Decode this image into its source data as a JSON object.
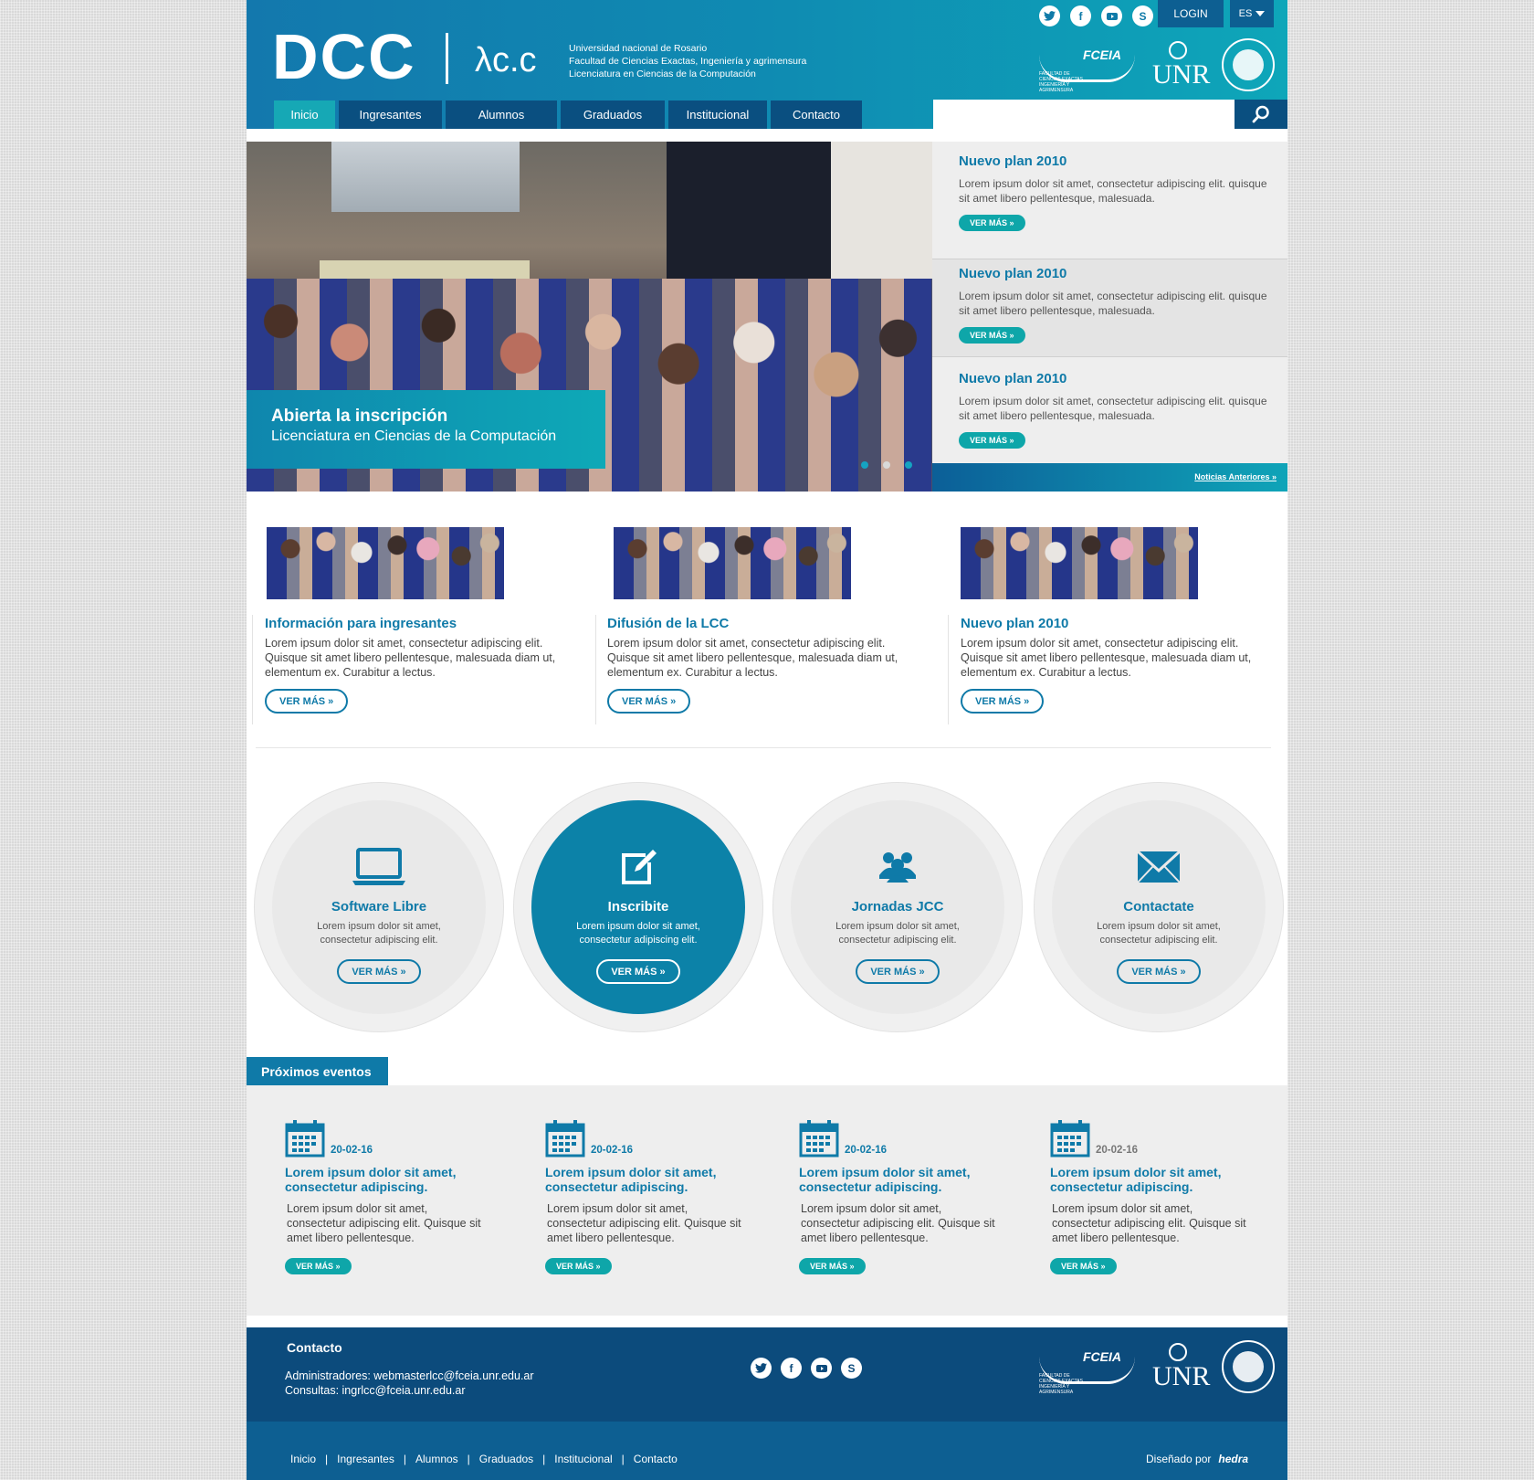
{
  "header": {
    "logo": "DCC",
    "logo_secondary": "λc.c",
    "lines": [
      "Universidad nacional de Rosario",
      "Facultad de Ciencias Exactas, Ingeniería y agrimensura",
      "Licenciatura en Ciencias de la Computación"
    ],
    "social": [
      "twitter-icon",
      "facebook-icon",
      "youtube-icon",
      "skype-icon"
    ],
    "login": "LOGIN",
    "lang": "ES",
    "logos": {
      "fceia": "FCEIA",
      "fceia_small": "FACULTAD DE CIENCIAS EXACTAS, INGENIERÍA Y AGRIMENSURA",
      "unr": "UNR"
    }
  },
  "nav": [
    {
      "label": "Inicio",
      "active": true
    },
    {
      "label": "Ingresantes",
      "active": false
    },
    {
      "label": "Alumnos",
      "active": false
    },
    {
      "label": "Graduados",
      "active": false
    },
    {
      "label": "Institucional",
      "active": false
    },
    {
      "label": "Contacto",
      "active": false
    }
  ],
  "search": {
    "placeholder": ""
  },
  "hero": {
    "title": "Abierta la inscripción",
    "subtitle": "Licenciatura en Ciencias de la Computación",
    "slides": 3,
    "active_slide": 1
  },
  "news": {
    "items": [
      {
        "title": "Nuevo plan 2010",
        "text": "Lorem ipsum dolor sit amet, consectetur adipiscing elit. quisque sit amet libero pellentesque, malesuada.",
        "button": "VER MÁS »"
      },
      {
        "title": "Nuevo plan 2010",
        "text": "Lorem ipsum dolor sit amet, consectetur adipiscing elit. quisque sit amet libero pellentesque, malesuada.",
        "button": "VER MÁS »"
      },
      {
        "title": "Nuevo plan 2010",
        "text": "Lorem ipsum dolor sit amet, consectetur adipiscing elit. quisque sit amet libero pellentesque, malesuada.",
        "button": "VER MÁS »"
      }
    ],
    "more": "Noticias Anteriores »"
  },
  "features": [
    {
      "title": "Información para ingresantes",
      "text": "Lorem ipsum dolor sit amet, consectetur adipiscing elit. Quisque sit amet libero pellentesque, malesuada diam ut, elementum ex. Curabitur a lectus.",
      "button": "VER MÁS »"
    },
    {
      "title": "Difusión de la LCC",
      "text": "Lorem ipsum dolor sit amet, consectetur adipiscing elit. Quisque sit amet libero pellentesque, malesuada diam ut, elementum ex. Curabitur a lectus.",
      "button": "VER MÁS »"
    },
    {
      "title": "Nuevo plan 2010",
      "text": "Lorem ipsum dolor sit amet, consectetur adipiscing elit. Quisque sit amet libero pellentesque, malesuada diam ut, elementum ex. Curabitur a lectus.",
      "button": "VER MÁS »"
    }
  ],
  "circles": [
    {
      "icon": "laptop-icon",
      "title": "Software Libre",
      "text": "Lorem ipsum dolor sit amet, consectetur adipiscing elit.",
      "button": "VER MÁS »"
    },
    {
      "icon": "edit-icon",
      "title": "Inscribite",
      "text": "Lorem ipsum dolor sit amet, consectetur adipiscing elit.",
      "button": "VER MÁS »"
    },
    {
      "icon": "users-icon",
      "title": "Jornadas JCC",
      "text": "Lorem ipsum dolor sit amet, consectetur adipiscing elit.",
      "button": "VER MÁS »"
    },
    {
      "icon": "envelope-icon",
      "title": "Contactate",
      "text": "Lorem ipsum dolor sit amet, consectetur adipiscing elit.",
      "button": "VER MÁS »"
    }
  ],
  "events": {
    "heading": "Próximos eventos",
    "items": [
      {
        "date": "20-02-16",
        "title": "Lorem ipsum dolor sit amet, consectetur adipiscing.",
        "text": "Lorem ipsum dolor sit amet, consectetur adipiscing elit. Quisque sit amet libero pellentesque.",
        "button": "VER MÁS »"
      },
      {
        "date": "20-02-16",
        "title": "Lorem ipsum dolor sit amet, consectetur adipiscing.",
        "text": "Lorem ipsum dolor sit amet, consectetur adipiscing elit. Quisque sit amet libero pellentesque.",
        "button": "VER MÁS »"
      },
      {
        "date": "20-02-16",
        "title": "Lorem ipsum dolor sit amet, consectetur adipiscing.",
        "text": "Lorem ipsum dolor sit amet, consectetur adipiscing elit. Quisque sit amet libero pellentesque.",
        "button": "VER MÁS »"
      },
      {
        "date": "20-02-16",
        "title": "Lorem ipsum dolor sit amet, consectetur adipiscing.",
        "text": "Lorem ipsum dolor sit amet, consectetur adipiscing elit. Quisque sit amet libero pellentesque.",
        "button": "VER MÁS »"
      }
    ]
  },
  "footer": {
    "title": "Contacto",
    "admin": "Administradores: webmasterlcc@fceia.unr.edu.ar",
    "consultas": "Consultas: ingrlcc@fceia.unr.edu.ar",
    "links": [
      "Inicio",
      "Ingresantes",
      "Alumnos",
      "Graduados",
      "Institucional",
      "Contacto"
    ],
    "credit_label": "Diseñado por",
    "credit_name": "hedra"
  },
  "colors": {
    "primary": "#0f7aa8",
    "accent": "#0ea6b9",
    "dark": "#0c4b7c"
  }
}
